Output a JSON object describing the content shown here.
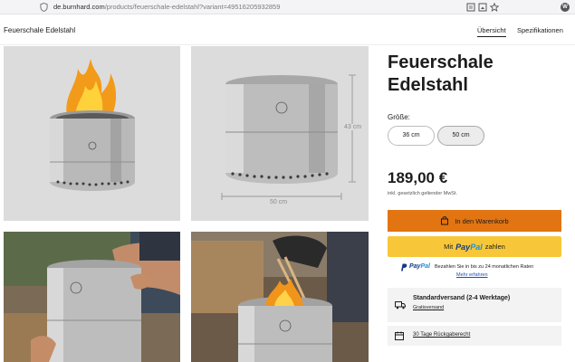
{
  "browser": {
    "url_domain": "de.burnhard.com",
    "url_path": "/products/feuerschale-edelstahl?variant=49516205932859",
    "avatar_letter": "W"
  },
  "header": {
    "title": "Feuerschale Edelstahl",
    "nav": [
      "Übersicht",
      "Spezifikationen"
    ]
  },
  "gallery": {
    "dimension_height": "43 cm",
    "dimension_width": "50 cm"
  },
  "product": {
    "name_line1": "Feuerschale",
    "name_line2": "Edelstahl",
    "size_label": "Größe:",
    "sizes": [
      "36 cm",
      "50 cm"
    ],
    "selected_size": "50 cm",
    "price": "189,00 €",
    "tax_note": "inkl. gesetzlich geltender MwSt.",
    "add_to_cart": "In den Warenkorb",
    "paypal_prefix": "Mit",
    "paypal_brand_a": "Pay",
    "paypal_brand_b": "Pal",
    "paypal_suffix": "zahlen",
    "paypal_logo": "PayPal",
    "paypal_info": "Bezahlen Sie in bis zu 24 monatlichen Raten",
    "paypal_more": "Mehr erfahren",
    "shipping_title": "Standardversand (2-4 Werktage)",
    "shipping_sub": "Gratisversand",
    "returns": "30 Tage Rückgaberecht"
  },
  "colors": {
    "cart_button": "#e27412",
    "paypal_button": "#f7c739",
    "paypal_dark": "#123a8a",
    "paypal_light": "#1b93d6"
  }
}
